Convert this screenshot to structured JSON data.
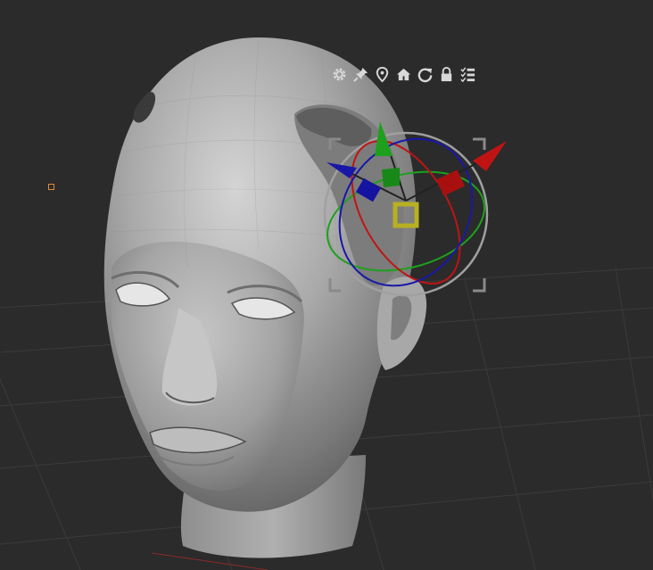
{
  "app": {
    "view": "3d-viewport",
    "background_color": "#2b2b2b",
    "grid_color": "#3a3a3a"
  },
  "gizmo_toolbar": {
    "icons": [
      {
        "name": "gear-icon",
        "tooltip": ""
      },
      {
        "name": "pin-icon",
        "tooltip": ""
      },
      {
        "name": "location-pin-icon",
        "tooltip": ""
      },
      {
        "name": "home-icon",
        "tooltip": ""
      },
      {
        "name": "reset-icon",
        "tooltip": ""
      },
      {
        "name": "lock-icon",
        "tooltip": ""
      },
      {
        "name": "checklist-icon",
        "tooltip": ""
      }
    ]
  },
  "gizmo": {
    "axis_colors": {
      "x": "#c01414",
      "y": "#1ea01e",
      "z": "#1818a8"
    },
    "center_handle_color": "#b8b020",
    "ring_color": "#9a9a9a"
  },
  "model": {
    "name": "",
    "color": "#9a9a9a"
  }
}
